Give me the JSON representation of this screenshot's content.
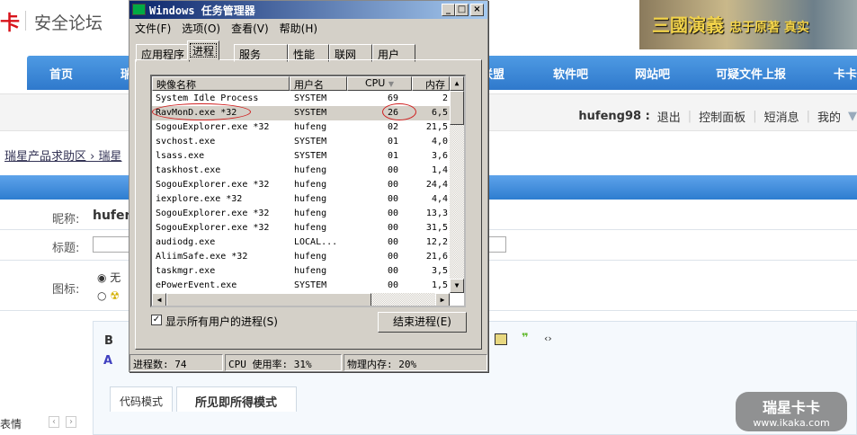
{
  "site": {
    "logo_mark": "卡",
    "logo_text": "安全论坛",
    "banner_text": "三國演義",
    "banner_slogan": "忠于原著 真实"
  },
  "nav": [
    {
      "label": "首页"
    },
    {
      "label": "瑞"
    },
    {
      "label": "联盟"
    },
    {
      "label": "软件吧"
    },
    {
      "label": "网站吧"
    },
    {
      "label": "可疑文件上报"
    },
    {
      "label": "卡卡"
    }
  ],
  "userbar": {
    "username": "hufeng98 :",
    "logout": "退出",
    "control_panel": "控制面板",
    "messages": "短消息",
    "mine": "我的"
  },
  "breadcrumb": {
    "item1": "瑞星产品求助区",
    "item2": "瑞星"
  },
  "form": {
    "nickname_label": "昵称:",
    "nickname_value": "hufen",
    "title_label": "标题:",
    "icon_label": "图标:",
    "icon_option_none": "无"
  },
  "editor": {
    "bold": "B",
    "tab_code": "代码模式",
    "tab_wysiwyg": "所见即所得模式",
    "emoticon_label": "表情"
  },
  "watermark": {
    "brand": "瑞星卡卡",
    "url": "www.ikaka.com"
  },
  "task_manager": {
    "title": "Windows 任务管理器",
    "menu": [
      "文件(F)",
      "选项(O)",
      "查看(V)",
      "帮助(H)"
    ],
    "tabs": [
      "应用程序",
      "进程",
      "服务",
      "性能",
      "联网",
      "用户"
    ],
    "active_tab": "进程",
    "columns": [
      "映像名称",
      "用户名",
      "CPU",
      "内存"
    ],
    "sort_column": "CPU",
    "rows": [
      [
        "System Idle Process",
        "SYSTEM",
        "69",
        "2"
      ],
      [
        "RavMonD.exe *32",
        "SYSTEM",
        "26",
        "6,5"
      ],
      [
        "SogouExplorer.exe *32",
        "hufeng",
        "02",
        "21,5"
      ],
      [
        "svchost.exe",
        "SYSTEM",
        "01",
        "4,0"
      ],
      [
        "lsass.exe",
        "SYSTEM",
        "01",
        "3,6"
      ],
      [
        "taskhost.exe",
        "hufeng",
        "00",
        "1,4"
      ],
      [
        "SogouExplorer.exe *32",
        "hufeng",
        "00",
        "24,4"
      ],
      [
        "iexplore.exe *32",
        "hufeng",
        "00",
        "4,4"
      ],
      [
        "SogouExplorer.exe *32",
        "hufeng",
        "00",
        "13,3"
      ],
      [
        "SogouExplorer.exe *32",
        "hufeng",
        "00",
        "31,5"
      ],
      [
        "audiodg.exe",
        "LOCAL...",
        "00",
        "12,2"
      ],
      [
        "AliimSafe.exe *32",
        "hufeng",
        "00",
        "21,6"
      ],
      [
        "taskmgr.exe",
        "hufeng",
        "00",
        "3,5"
      ],
      [
        "ePowerEvent.exe",
        "SYSTEM",
        "00",
        "1,5"
      ]
    ],
    "selected_row": 1,
    "show_all_users_label": "显示所有用户的进程(S)",
    "show_all_users_checked": true,
    "end_process_label": "结束进程(E)",
    "status": {
      "processes": "进程数: 74",
      "cpu": "CPU 使用率: 31%",
      "memory": "物理内存: 20%"
    },
    "annotation_color": "#d02020"
  }
}
